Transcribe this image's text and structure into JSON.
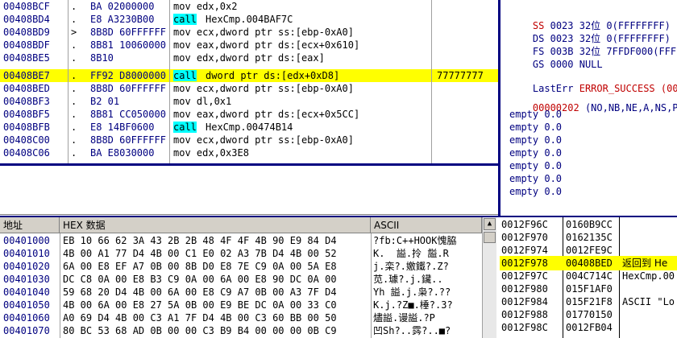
{
  "disasm": {
    "rows": [
      {
        "addr": "00408BCF",
        "mark": ".",
        "hex": "BA 02000000",
        "asm": "mov edx,0x2",
        "cmt": ""
      },
      {
        "addr": "00408BD4",
        "mark": ".",
        "hex": "E8 A3230B00",
        "kw": "call",
        "asm": "HexCmp.004BAF7C",
        "cmt": ""
      },
      {
        "addr": "00408BD9",
        "mark": ">",
        "hex": "8B8D 60FFFFFF",
        "asm": "mov ecx,dword ptr ss:[ebp-0xA0]",
        "cmt": ""
      },
      {
        "addr": "00408BDF",
        "mark": ".",
        "hex": "8B81 10060000",
        "asm": "mov eax,dword ptr ds:[ecx+0x610]",
        "cmt": ""
      },
      {
        "addr": "00408BE5",
        "mark": ".",
        "hex": "8B10",
        "asm": "mov edx,dword ptr ds:[eax]",
        "cmt": ""
      },
      {
        "addr": "00408BE7",
        "mark": ".",
        "hex": "FF92 D8000000",
        "kw": "call",
        "asm": "dword ptr ds:[edx+0xD8]",
        "cmt": "77777777"
      },
      {
        "addr": "00408BED",
        "mark": ".",
        "hex": "8B8D 60FFFFFF",
        "asm": "mov ecx,dword ptr ss:[ebp-0xA0]",
        "cmt": ""
      },
      {
        "addr": "00408BF3",
        "mark": ".",
        "hex": "B2 01",
        "asm": "mov dl,0x1",
        "cmt": ""
      },
      {
        "addr": "00408BF5",
        "mark": ".",
        "hex": "8B81 CC050000",
        "asm": "mov eax,dword ptr ds:[ecx+0x5CC]",
        "cmt": ""
      },
      {
        "addr": "00408BFB",
        "mark": ".",
        "hex": "E8 14BF0600",
        "kw": "call",
        "asm": "HexCmp.00474B14",
        "cmt": ""
      },
      {
        "addr": "00408C00",
        "mark": ".",
        "hex": "8B8D 60FFFFFF",
        "asm": "mov ecx,dword ptr ss:[ebp-0xA0]",
        "cmt": ""
      },
      {
        "addr": "00408C06",
        "mark": ".",
        "hex": "BA E8030000",
        "asm": "mov edx,0x3E8",
        "cmt": ""
      }
    ]
  },
  "registers": {
    "segs": [
      {
        "name": "SS",
        "sel": "0023",
        "bits": "32位",
        "base": "0(FFFFFFFF)"
      },
      {
        "name": "DS",
        "sel": "0023",
        "bits": "32位",
        "base": "0(FFFFFFFF)"
      },
      {
        "name": "FS",
        "sel": "003B",
        "bits": "32位",
        "base": "7FFDF000(FFF)"
      },
      {
        "name": "GS",
        "sel": "0000",
        "bits": "NULL",
        "base": ""
      }
    ],
    "lasterr_label": "LastErr",
    "lasterr_value": "ERROR_SUCCESS (000",
    "eflags_value": "00000202",
    "eflags_flags": "(NO,NB,NE,A,NS,PO,",
    "fpu": [
      "empty 0.0",
      "empty 0.0",
      "empty 0.0",
      "empty 0.0",
      "empty 0.0",
      "empty 0.0",
      "empty 0.0"
    ]
  },
  "dump": {
    "col_addr": "地址",
    "col_hex": "HEX 数据",
    "col_ascii": "ASCII",
    "rows": [
      {
        "addr": "00401000",
        "hex": "EB 10 66 62 3A 43 2B 2B 48 4F 4F 4B 90 E9 84 D4",
        "ascii": "?fb:C++HOOK愧脇"
      },
      {
        "addr": "00401010",
        "hex": "4B 00 A1 77 D4 4B 00 C1 E0 02 A3 7B D4 4B 00 52",
        "ascii": "K.  謚.拎 ̄謚.R"
      },
      {
        "addr": "00401020",
        "hex": "6A 00 E8 EF A7 0B 00 8B D0 E8 7E C9 0A 00 5A E8",
        "ascii": "j.栾?.嬓鐵?.Z?"
      },
      {
        "addr": "00401030",
        "hex": "DC C8 0A 00 E8 B3 C9 0A 00 6A 00 E8 90 DC 0A 00",
        "ascii": "苋.璩?.j.鑶.."
      },
      {
        "addr": "00401040",
        "hex": "59 68 20 D4 4B 00 6A 00 E8 C9 A7 0B 00 A3 7F D4",
        "ascii": "Yh 謚.j.枭?.??"
      },
      {
        "addr": "00401050",
        "hex": "4B 00 6A 00 E8 27 5A 0B 00 E9 BE DC 0A 00 33 C0",
        "ascii": "K.j.?Z■.棰?.3?"
      },
      {
        "addr": "00401060",
        "hea": "",
        "hex": "A0 69 D4 4B 00 C3 A1 7F D4 4B 00 C3 60 BB 00 50",
        "ascii": "燼謚.谩謚.?P"
      },
      {
        "addr": "00401070",
        "hex": "80 BC 53 68 AD 0B 00 00 C3 B9 B4 00 00 00 0B C9",
        "ascii": "凹Sh?..霠?..■?"
      }
    ]
  },
  "stack": {
    "rows": [
      {
        "addr": "0012F96C",
        "val": "0160B9CC",
        "cmt": ""
      },
      {
        "addr": "0012F970",
        "val": "0162135C",
        "cmt": ""
      },
      {
        "addr": "0012F974",
        "val": "0012FE9C",
        "cmt": ""
      },
      {
        "addr": "0012F978",
        "val": "00408BED",
        "cmt": "返回到 He"
      },
      {
        "addr": "0012F97C",
        "val": "004C714C",
        "cmt": "HexCmp.00"
      },
      {
        "addr": "0012F980",
        "val": "015F1AF0",
        "cmt": ""
      },
      {
        "addr": "0012F984",
        "val": "015F21F8",
        "cmt": "ASCII \"Lo"
      },
      {
        "addr": "0012F988",
        "val": "01770150",
        "cmt": ""
      },
      {
        "addr": "0012F98C",
        "val": "0012FB04",
        "cmt": ""
      }
    ]
  }
}
